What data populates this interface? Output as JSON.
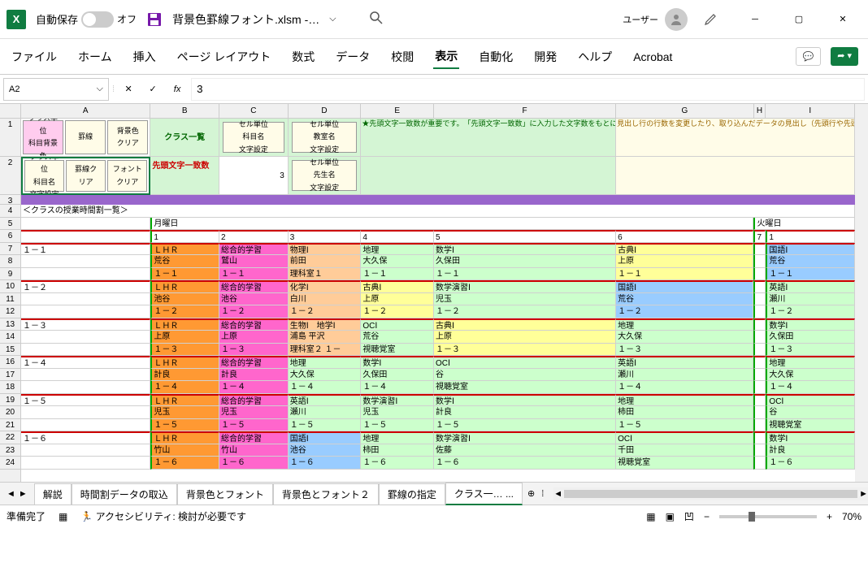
{
  "title": {
    "autosave": "自動保存",
    "autosave_state": "オフ",
    "filename": "背景色罫線フォント.xlsm ‑…",
    "user": "ユーザー"
  },
  "ribbon": {
    "tabs": [
      "ファイル",
      "ホーム",
      "挿入",
      "ページ レイアウト",
      "数式",
      "データ",
      "校閲",
      "表示",
      "自動化",
      "開発",
      "ヘルプ",
      "Acrobat"
    ],
    "active": "表示"
  },
  "namebox": "A2",
  "formula_value": "3",
  "col_labels": [
    "A",
    "B",
    "C",
    "D",
    "E",
    "F",
    "G",
    "H",
    "I"
  ],
  "row_labels": [
    "",
    "1",
    "2",
    "3",
    "4",
    "5",
    "6",
    "7",
    "8",
    "9",
    "10",
    "11",
    "12",
    "13",
    "14",
    "15",
    "16",
    "17",
    "18",
    "19",
    "20",
    "21",
    "22",
    "23",
    "24"
  ],
  "buttons": {
    "r1": [
      "クラス単位\n科目背景\n色",
      "罫線",
      "背景色\nクリア"
    ],
    "r2": [
      "クラス単位\n科目名\n文字設定",
      "罫線ク\nリア",
      "フォント\nクリア"
    ],
    "b1_label": "クラス一覧",
    "c1_btn": "セル単位\n科目名\n文字設定",
    "d1_btn": "セル単位\n教室名\n文字設定",
    "d2_btn": "セル単位\n先生名\n文字設定",
    "b2_label": "先頭文字一致数"
  },
  "help_e": "★先頭文字一致数が重要です。　「先頭文字一致数」に入力した文字数をもとに、「背景色とフォント」「背景色とフォント２」シートに、一致した名称を探し、一致したら対応する色で背景色や文字を塗ってゆきます。　★罫線　「罫線の指定」シートで指定した線で、「有」を設定した枠を対象に罫線を描きます。",
  "help_g": "見出し行の行数を変更したり、取り込んだデータの見出し（先頭行や先頭列のクラスや時間など）の内容や表示行を変更しないで下さい。データの先頭行番号・先頭列番号・クラス名・先生名・時間、見出し行数・列数などはマクロで参照しています。これらの変更（１列目クラス名の見出し位置を中央寄りにしたいな",
  "row4_title": "＜クラスの授業時間割一覧＞",
  "row5": {
    "b": "月曜日",
    "i": "火曜日"
  },
  "row6": {
    "b": "1",
    "c": "2",
    "d": "3",
    "e": "4",
    "f": "5",
    "g": "6",
    "h": "7",
    "i": "1"
  },
  "schedule": [
    {
      "cls": "１－１",
      "b": [
        "ＬＨＲ",
        "荒谷",
        "１－１"
      ],
      "c": [
        "総合的学習",
        "鷲山",
        "１－１"
      ],
      "d": [
        "物理Ⅰ",
        "前田",
        "理科室１"
      ],
      "e": [
        "地理",
        "大久保",
        "１－１"
      ],
      "f": [
        "数学Ⅰ",
        "久保田",
        "１－１"
      ],
      "g": [
        "古典Ⅰ",
        "上原",
        "１－１"
      ],
      "i": [
        "国語Ⅰ",
        "荒谷",
        "１－１"
      ]
    },
    {
      "cls": "１－２",
      "b": [
        "ＬＨＲ",
        "池谷",
        "１－２"
      ],
      "c": [
        "総合的学習",
        "池谷",
        "１－２"
      ],
      "d": [
        "化学Ⅰ",
        "白川",
        "１－２"
      ],
      "e": [
        "古典Ⅰ",
        "上原",
        "１－２"
      ],
      "f": [
        "数学演習Ⅰ",
        "児玉",
        "１－２"
      ],
      "g": [
        "国語Ⅰ",
        "荒谷",
        "１－２"
      ],
      "i": [
        "英語Ⅰ",
        "瀬川",
        "１－２"
      ]
    },
    {
      "cls": "１－３",
      "b": [
        "ＬＨＲ",
        "上原",
        "１－３"
      ],
      "c": [
        "総合的学習",
        "上原",
        "１－３"
      ],
      "d": [
        "生物Ⅰ　地学Ⅰ",
        "浦島 平沢",
        "理科室２ １－"
      ],
      "e": [
        "OCⅠ",
        "荒谷",
        "視聴覚室"
      ],
      "f": [
        "古典Ⅰ",
        "上原",
        "１－３"
      ],
      "g": [
        "地理",
        "大久保",
        "１－３"
      ],
      "i": [
        "数学Ⅰ",
        "久保田",
        "１－３"
      ]
    },
    {
      "cls": "１－４",
      "b": [
        "ＬＨＲ",
        "計良",
        "１－４"
      ],
      "c": [
        "総合的学習",
        "計良",
        "１－４"
      ],
      "d": [
        "地理",
        "大久保",
        "１－４"
      ],
      "e": [
        "数学Ⅰ",
        "久保田",
        "１－４"
      ],
      "f": [
        "OCⅠ",
        "谷",
        "視聴覚室"
      ],
      "g": [
        "英語Ⅰ",
        "瀬川",
        "１－４"
      ],
      "i": [
        "地理",
        "大久保",
        "１－４"
      ]
    },
    {
      "cls": "１－５",
      "b": [
        "ＬＨＲ",
        "児玉",
        "１－５"
      ],
      "c": [
        "総合的学習",
        "児玉",
        "１－５"
      ],
      "d": [
        "英語Ⅰ",
        "瀬川",
        "１－５"
      ],
      "e": [
        "数学演習Ⅰ",
        "児玉",
        "１－５"
      ],
      "f": [
        "数学Ⅰ",
        "計良",
        "１－５"
      ],
      "g": [
        "地理",
        "柿田",
        "１－５"
      ],
      "i": [
        "OCⅠ",
        "谷",
        "視聴覚室"
      ]
    },
    {
      "cls": "１－６",
      "b": [
        "ＬＨＲ",
        "竹山",
        "１－６"
      ],
      "c": [
        "総合的学習",
        "竹山",
        "１－６"
      ],
      "d": [
        "国語Ⅰ",
        "池谷",
        "１－６"
      ],
      "e": [
        "地理",
        "柿田",
        "１－６"
      ],
      "f": [
        "数学演習Ⅰ",
        "佐藤",
        "１－６"
      ],
      "g": [
        "OCⅠ",
        "千田",
        "視聴覚室"
      ],
      "i": [
        "数学Ⅰ",
        "計良",
        "１－６"
      ]
    }
  ],
  "colors": {
    "lhr": "#ff9933",
    "sogo": "#ff66cc",
    "sci": "#ffcc99",
    "geo": "#ccffcc",
    "math": "#ccffcc",
    "classic": "#ffff99",
    "kokugo": "#99ccff",
    "eng": "#ccffcc",
    "oc": "#ccffcc",
    "panel_yellow": "#fffce8",
    "panel_green": "#d4f5d4",
    "panel_pink": "#ffccee"
  },
  "sheet_tabs": [
    "解説",
    "時間割データの取込",
    "背景色とフォント",
    "背景色とフォント２",
    "罫線の指定",
    "クラス一… ..."
  ],
  "active_sheet": "クラス一… ...",
  "statusbar": {
    "ready": "準備完了",
    "accessibility": "アクセシビリティ: 検討が必要です",
    "zoom": "70%"
  }
}
